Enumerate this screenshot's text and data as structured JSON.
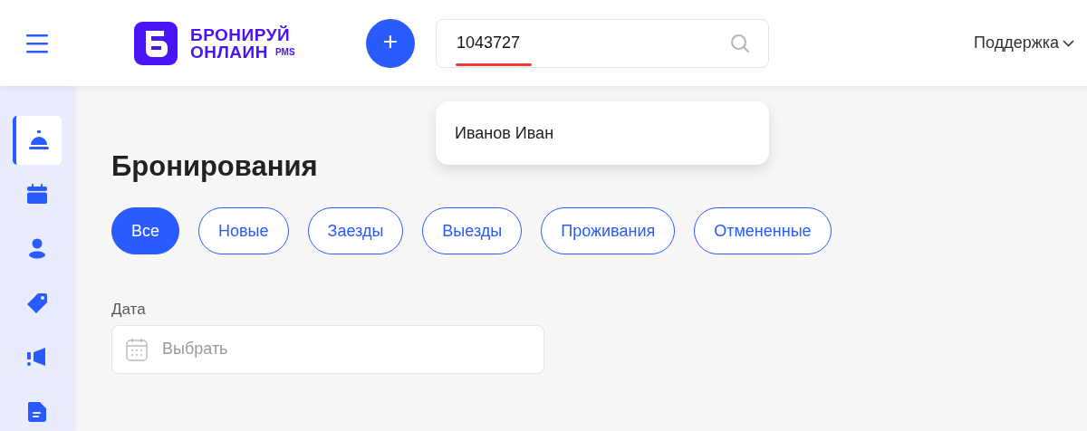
{
  "header": {
    "logo": {
      "line1": "БРОНИРУЙ",
      "line2": "ОНЛАИН",
      "suffix": "PMS"
    },
    "add_button": "+",
    "search": {
      "value": "1043727"
    },
    "support": "Поддержка"
  },
  "search_results": [
    {
      "name": "Иванов Иван"
    }
  ],
  "sidebar": {
    "items": [
      {
        "selected": true
      },
      {
        "selected": false
      },
      {
        "selected": false
      },
      {
        "selected": false
      },
      {
        "selected": false
      },
      {
        "selected": false
      }
    ]
  },
  "title": "Бронирования",
  "filters": [
    {
      "label": "Все",
      "selected": true
    },
    {
      "label": "Новые",
      "selected": false
    },
    {
      "label": "Заезды",
      "selected": false
    },
    {
      "label": "Выезды",
      "selected": false
    },
    {
      "label": "Проживания",
      "selected": false
    },
    {
      "label": "Отмененные",
      "selected": false
    }
  ],
  "date_filter": {
    "label": "Дата",
    "placeholder": "Выбрать"
  }
}
